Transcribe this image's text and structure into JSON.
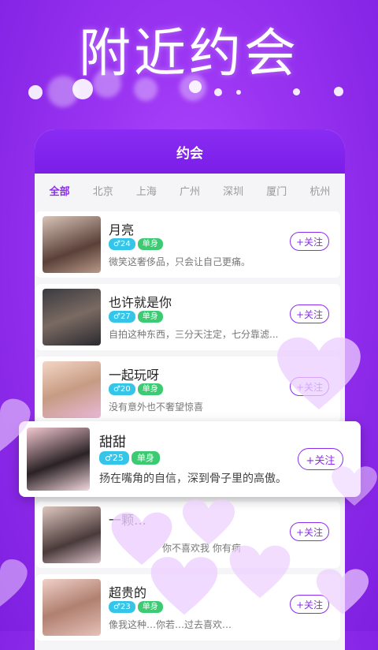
{
  "hero": {
    "title": "附近约会"
  },
  "card": {
    "title": "约会"
  },
  "tabs": [
    "全部",
    "北京",
    "上海",
    "广州",
    "深圳",
    "厦门",
    "杭州"
  ],
  "users": [
    {
      "name": "月亮",
      "age": "♂24",
      "status": "单身",
      "signature": "微笑这奢侈品，只会让自己更痛。",
      "follow": "+关注"
    },
    {
      "name": "也许就是你",
      "age": "♂27",
      "status": "单身",
      "signature": "自拍这种东西，三分天注定，七分靠滤...",
      "follow": "+关注"
    },
    {
      "name": "一起玩呀",
      "age": "♂20",
      "status": "单身",
      "signature": "没有意外也不奢望惊喜",
      "follow": "+关注"
    },
    {
      "name": "一颗…",
      "age": "",
      "status": "",
      "signature": "你不喜欢我 你有病",
      "follow": "+关注"
    },
    {
      "name": "超贵的",
      "age": "♂23",
      "status": "单身",
      "signature": "像我这种…你若…过去喜欢…",
      "follow": "+关注"
    }
  ],
  "popup": {
    "name": "甜甜",
    "age": "♂25",
    "status": "单身",
    "signature": "扬在嘴角的自信，深到骨子里的高傲。",
    "follow": "+关注"
  },
  "colors": {
    "accent": "#8b2cf0",
    "age_tag": "#35c5e8",
    "single_tag": "#3ccb72"
  }
}
